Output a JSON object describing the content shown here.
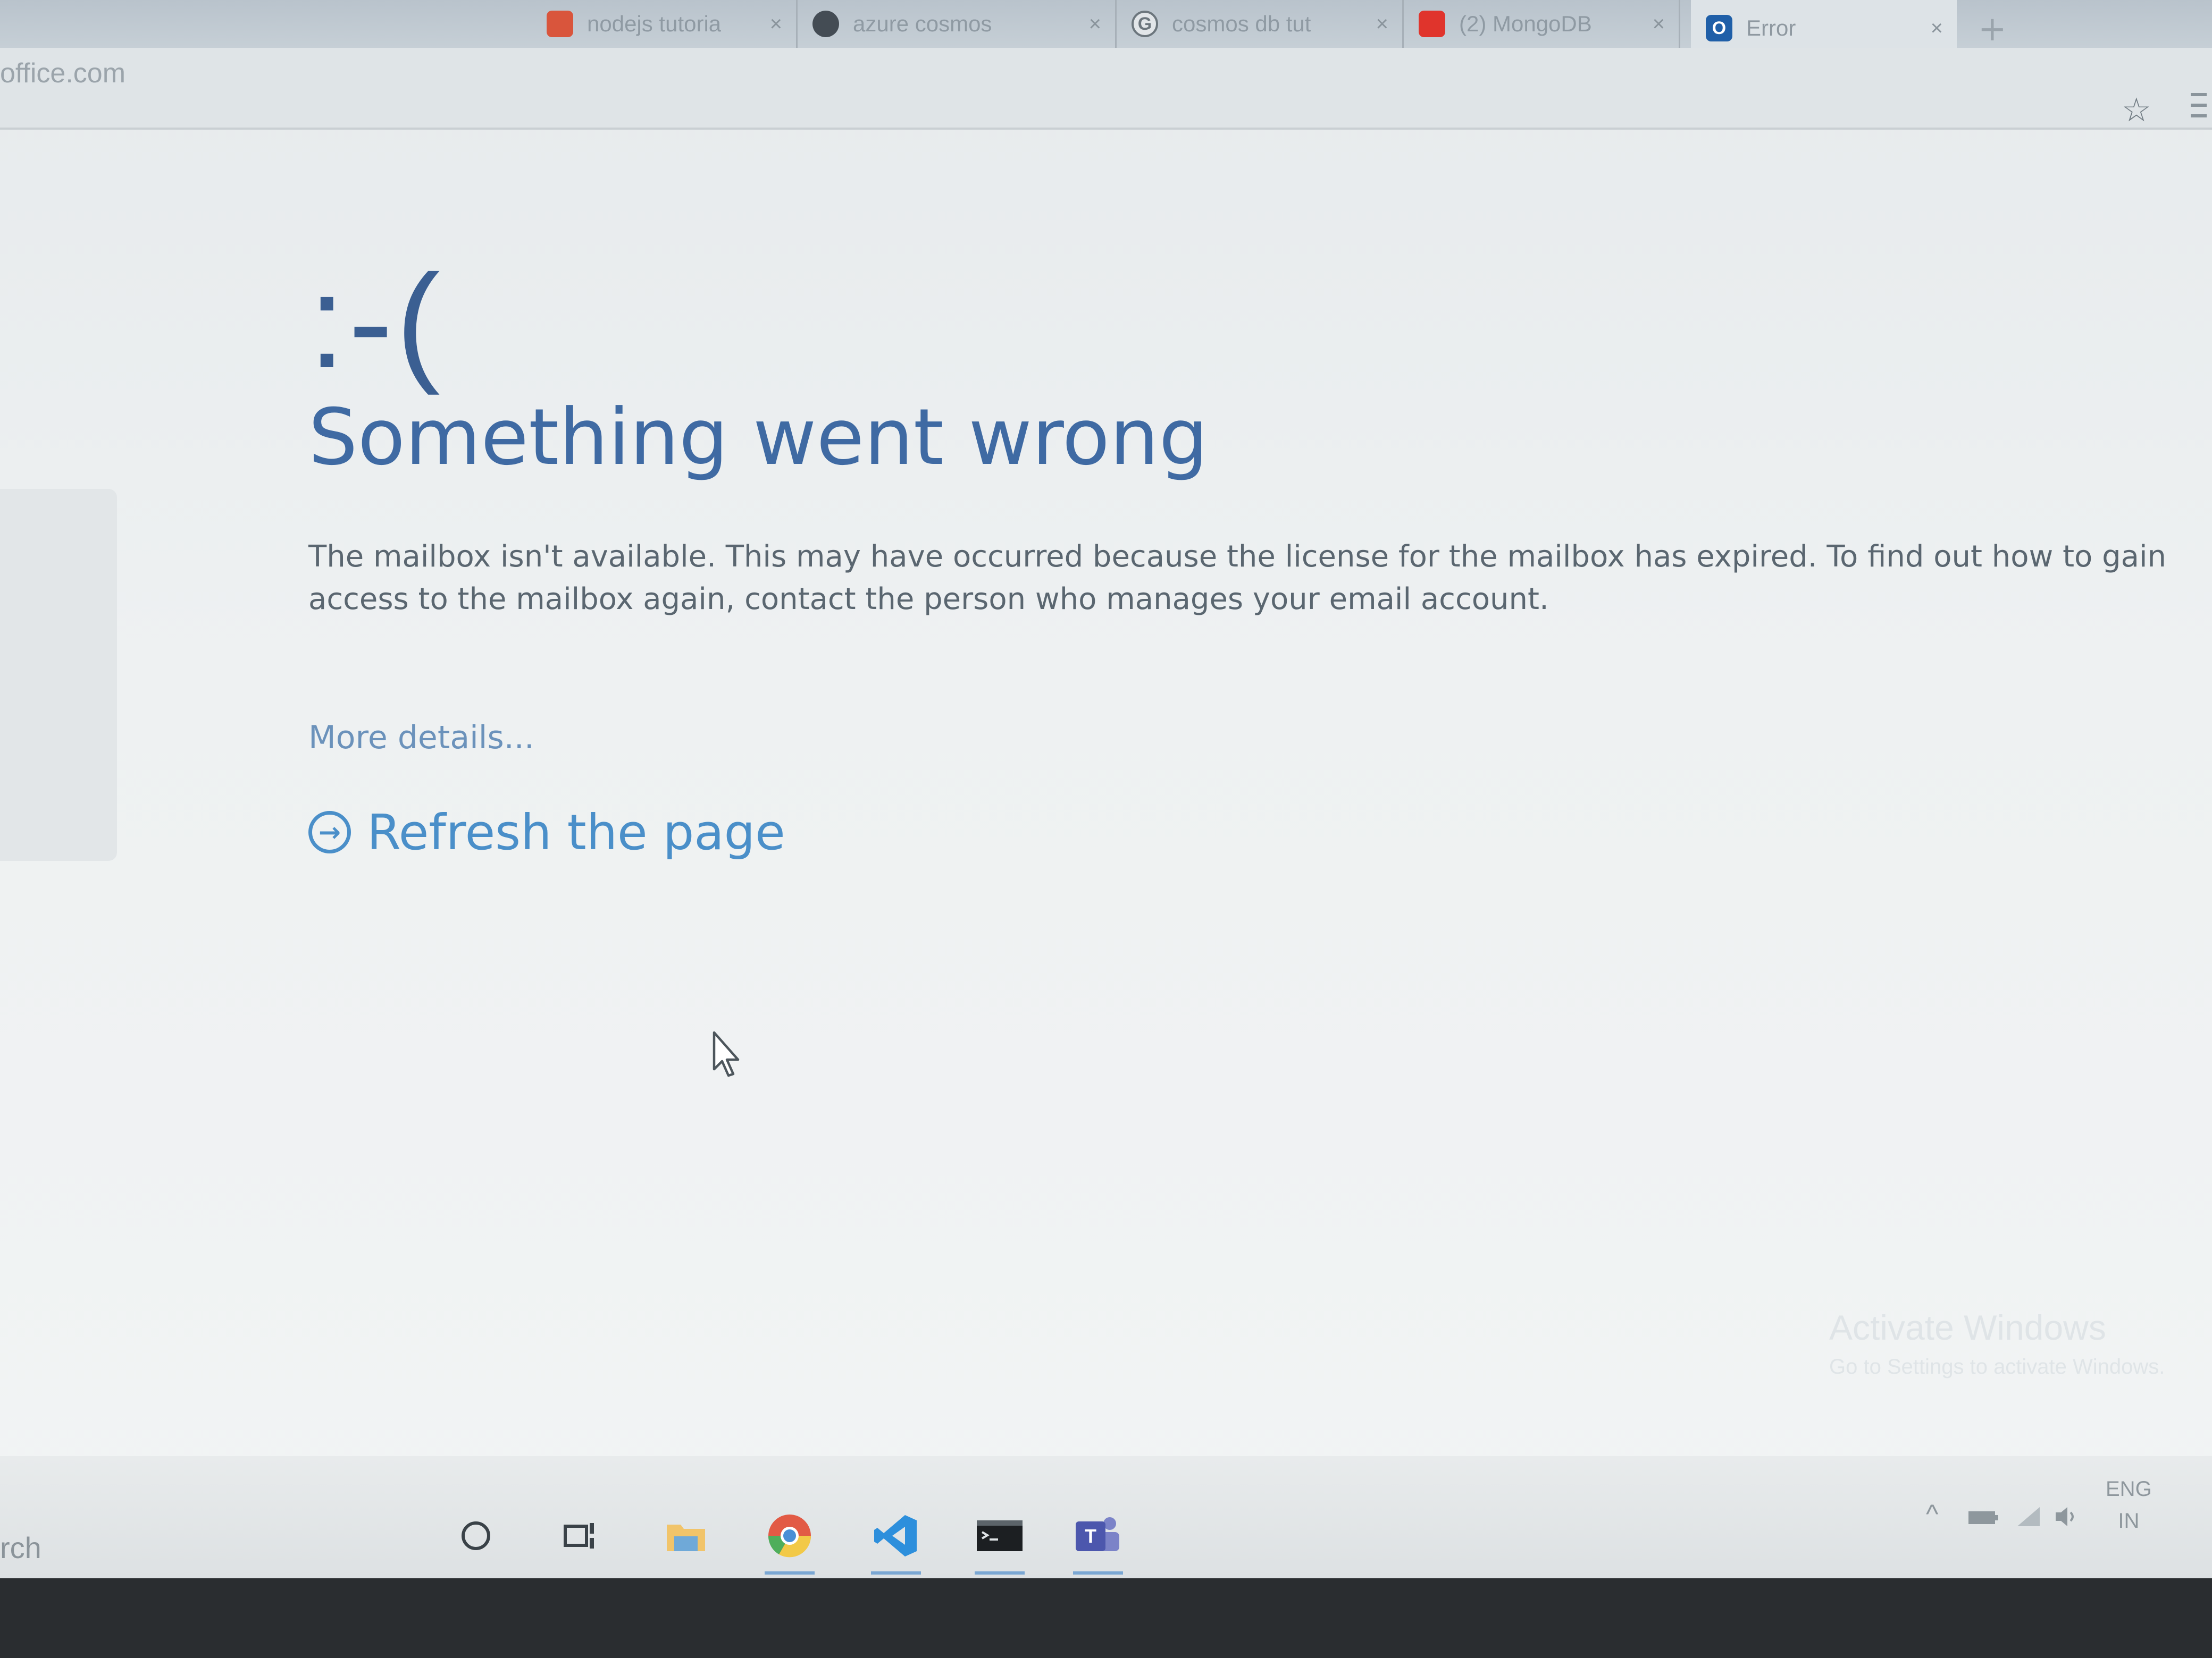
{
  "browser": {
    "tabs": [
      {
        "label": "nodejs tutoria",
        "favicon": "multicolor-icon",
        "color": "#d9553c"
      },
      {
        "label": "azure cosmos",
        "favicon": "github-icon",
        "color": "#444c54"
      },
      {
        "label": "cosmos db tut",
        "favicon": "google-icon",
        "color": "#e2e6e9"
      },
      {
        "label": "(2) MongoDB",
        "favicon": "youtube-icon",
        "color": "#e0342c"
      },
      {
        "label": "Error",
        "favicon": "outlook-icon",
        "color": "#1f5fa8",
        "active": true
      }
    ],
    "close_glyph": "×",
    "new_tab_glyph": "+",
    "url": "office.com",
    "bookmark_glyph": "☆"
  },
  "error": {
    "face": ":-(",
    "title": "Something went wrong",
    "message": "The mailbox isn't available. This may have occurred because the license for the mailbox has expired. To find out how to gain access to the mailbox again, contact the person who manages your email account.",
    "more_details": "More details...",
    "refresh_label": "Refresh the page",
    "refresh_icon": "→"
  },
  "watermark": {
    "title": "Activate Windows",
    "subtitle": "Go to Settings to activate Windows."
  },
  "taskbar": {
    "search_text": "rch",
    "icons": [
      "cortana-icon",
      "task-view-icon",
      "file-explorer-icon",
      "chrome-icon",
      "vscode-icon",
      "terminal-icon",
      "teams-icon"
    ],
    "tray": {
      "language": "ENG",
      "region": "IN"
    }
  },
  "colors": {
    "title_blue": "#3f6aa3",
    "link_blue": "#4a8fc9",
    "body_gray": "#5a6670"
  }
}
